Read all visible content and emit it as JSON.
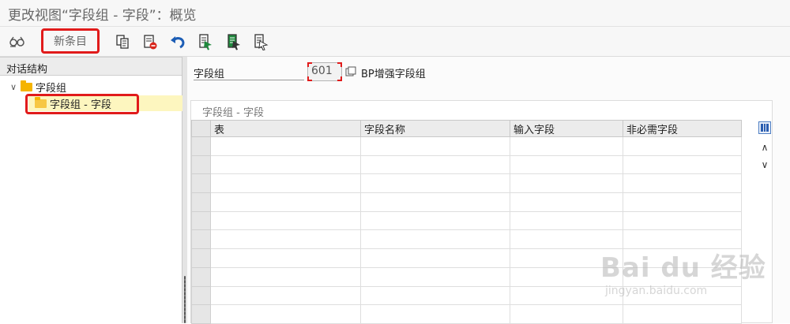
{
  "window": {
    "title": "更改视图“字段组 - 字段”：概览"
  },
  "toolbar": {
    "new_entry_label": "新条目",
    "icons": [
      "glasses-icon",
      "copy-icon",
      "delete-icon",
      "undo-icon",
      "select-all-icon",
      "select-block-icon",
      "deselect-all-icon"
    ]
  },
  "tree": {
    "header": "对话结构",
    "items": [
      {
        "label": "字段组",
        "level": 0,
        "expanded": true
      },
      {
        "label": "字段组 - 字段",
        "level": 1,
        "selected": true
      }
    ]
  },
  "form": {
    "field_label": "字段组",
    "field_value": "601",
    "field_desc": "BP增强字段组"
  },
  "group": {
    "title": "字段组 - 字段",
    "columns": [
      "表",
      "字段名称",
      "输入字段",
      "非必需字段"
    ]
  },
  "watermark": {
    "brand": "Bai du 经验",
    "url": "jingyan.baidu.com"
  },
  "colors": {
    "highlight": "#e11b1b",
    "selected_row": "#fdf6bf",
    "folder": "#f5b400",
    "toolbar_icon_blue": "#1c5db5",
    "toolbar_icon_green": "#1f8a3d"
  }
}
